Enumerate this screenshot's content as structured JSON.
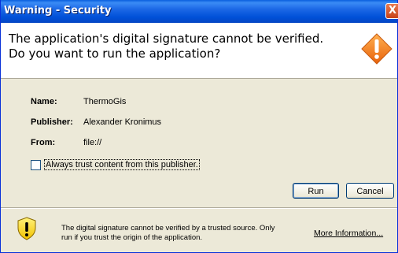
{
  "window": {
    "title": "Warning - Security",
    "close_glyph": "X"
  },
  "header": {
    "line1": "The application's digital signature cannot be verified.",
    "line2": "Do you want to run the application?",
    "icon": "warning-diamond-icon",
    "icon_color": "#f07d1e"
  },
  "details": {
    "name_label": "Name:",
    "name_value": "ThermoGis",
    "publisher_label": "Publisher:",
    "publisher_value": "Alexander Kronimus",
    "from_label": "From:",
    "from_value": "file://"
  },
  "trust_checkbox": {
    "label": "Always trust content from this publisher.",
    "checked": false
  },
  "buttons": {
    "run": "Run",
    "cancel": "Cancel"
  },
  "footer": {
    "line1": "The digital signature cannot be verified by a trusted source.  Only",
    "line2": "run if you trust the origin of the application.",
    "more_info_link": "More Information...",
    "icon": "warning-shield-icon"
  },
  "colors": {
    "title_bar": "#0054e3",
    "dialog_bg": "#ece9d8",
    "header_bg": "#ffffff"
  }
}
